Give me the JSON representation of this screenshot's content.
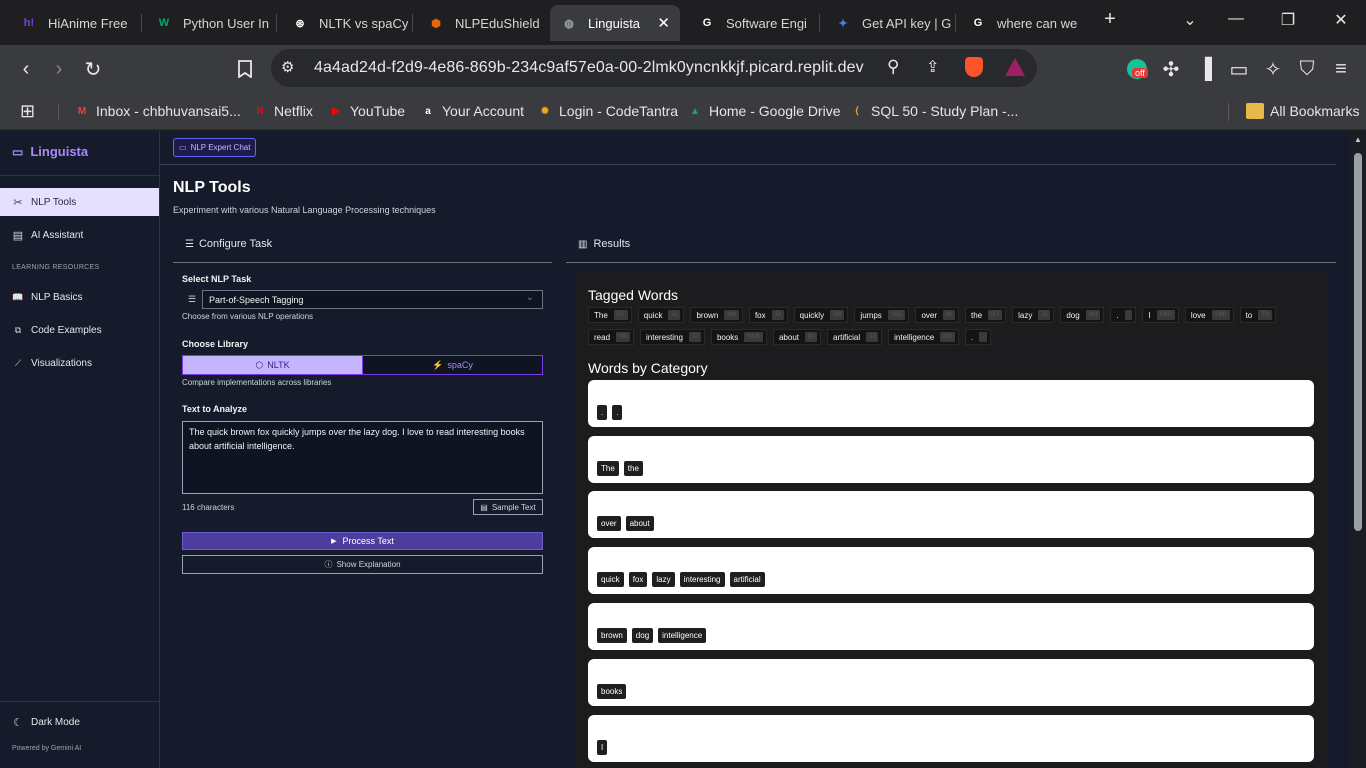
{
  "browser": {
    "tabs": [
      {
        "title": "HiAnime Free",
        "icon": "hianime-icon",
        "color": "#7c3aed",
        "glyph": "h!"
      },
      {
        "title": "Python User In",
        "icon": "w3schools-icon",
        "color": "#04aa6d",
        "glyph": "W"
      },
      {
        "title": "NLTK vs spaCy",
        "icon": "chatgpt-icon",
        "color": "#ffffff",
        "glyph": "⊛"
      },
      {
        "title": "NLPEduShield",
        "icon": "replit-icon",
        "color": "#f26207",
        "glyph": "⬢"
      },
      {
        "title": "Linguista",
        "icon": "globe-icon",
        "color": "#9aa0a6",
        "glyph": "◍"
      },
      {
        "title": "Software Engi",
        "icon": "google-icon",
        "color": "#ffffff",
        "glyph": "G"
      },
      {
        "title": "Get API key | G",
        "icon": "gemini-icon",
        "color": "#4285f4",
        "glyph": "✦"
      },
      {
        "title": "where can we",
        "icon": "google-icon",
        "color": "#ffffff",
        "glyph": "G"
      }
    ],
    "active_tab_index": 4,
    "url": "4a4ad24d-f2d9-4e86-869b-234c9af57e0a-00-2lmk0yncnkkjf.picard.replit.dev",
    "extension_badge": "off",
    "bookmarks": [
      {
        "label": "Inbox - chbhuvansai5...",
        "icon": "gmail-icon",
        "color": "#ea4335",
        "glyph": "M"
      },
      {
        "label": "Netflix",
        "icon": "netflix-icon",
        "color": "#e50914",
        "glyph": "N"
      },
      {
        "label": "YouTube",
        "icon": "youtube-icon",
        "color": "#ff0000",
        "glyph": "▶"
      },
      {
        "label": "Your Account",
        "icon": "amazon-icon",
        "color": "#ffffff",
        "glyph": "a"
      },
      {
        "label": "Login - CodeTantra",
        "icon": "codetantra-icon",
        "color": "#f5a623",
        "glyph": "✹"
      },
      {
        "label": "Home - Google Drive",
        "icon": "google-drive-icon",
        "color": "#1fa463",
        "glyph": "▲"
      },
      {
        "label": "SQL 50 - Study Plan -...",
        "icon": "leetcode-icon",
        "color": "#ffa116",
        "glyph": "⟨"
      }
    ],
    "all_bookmarks_label": "All Bookmarks"
  },
  "sidebar": {
    "brand": "Linguista",
    "items": [
      {
        "label": "NLP Tools",
        "icon": "tools-icon",
        "glyph": "✂",
        "active": true
      },
      {
        "label": "AI Assistant",
        "icon": "chat-icon",
        "glyph": "▤",
        "active": false
      }
    ],
    "section_heading": "LEARNING RESOURCES",
    "resources": [
      {
        "label": "NLP Basics",
        "icon": "book-icon",
        "glyph": "📖"
      },
      {
        "label": "Code Examples",
        "icon": "code-icon",
        "glyph": "⧉"
      },
      {
        "label": "Visualizations",
        "icon": "chart-icon",
        "glyph": "⟋"
      }
    ],
    "dark_mode_label": "Dark Mode",
    "powered_by": "Powered by Gemini AI"
  },
  "main": {
    "chat_button": "NLP Expert Chat",
    "title": "NLP Tools",
    "subtitle": "Experiment with various Natural Language Processing techniques",
    "configure": {
      "title": "Configure Task",
      "select_label": "Select NLP Task",
      "select_value": "Part-of-Speech Tagging",
      "select_hint": "Choose from various NLP operations",
      "library_label": "Choose Library",
      "library_options": [
        "NLTK",
        "spaCy"
      ],
      "library_selected": "NLTK",
      "library_hint": "Compare implementations across libraries",
      "text_label": "Text to Analyze",
      "text_value": "The quick brown fox quickly jumps over the lazy dog. I love to read interesting books about artificial intelligence.",
      "char_count": "116 characters",
      "sample_button": "Sample Text",
      "process_button": "Process Text",
      "explain_button": "Show Explanation"
    },
    "results": {
      "title": "Results",
      "tagged_heading": "Tagged Words",
      "tagged_words": [
        {
          "word": "The",
          "tag": "DT"
        },
        {
          "word": "quick",
          "tag": "JJ"
        },
        {
          "word": "brown",
          "tag": "NN"
        },
        {
          "word": "fox",
          "tag": "JJ"
        },
        {
          "word": "quickly",
          "tag": "RB"
        },
        {
          "word": "jumps",
          "tag": "VBZ"
        },
        {
          "word": "over",
          "tag": "IN"
        },
        {
          "word": "the",
          "tag": "DT"
        },
        {
          "word": "lazy",
          "tag": "JJ"
        },
        {
          "word": "dog",
          "tag": "NN"
        },
        {
          "word": ".",
          "tag": "."
        },
        {
          "word": "I",
          "tag": "PRP"
        },
        {
          "word": "love",
          "tag": "VBP"
        },
        {
          "word": "to",
          "tag": "TO"
        },
        {
          "word": "read",
          "tag": "VB"
        },
        {
          "word": "interesting",
          "tag": "JJ"
        },
        {
          "word": "books",
          "tag": "NNS"
        },
        {
          "word": "about",
          "tag": "IN"
        },
        {
          "word": "artificial",
          "tag": "JJ"
        },
        {
          "word": "intelligence",
          "tag": "NN"
        },
        {
          "word": ".",
          "tag": "."
        }
      ],
      "category_heading": "Words by Category",
      "categories": [
        [
          ".",
          "."
        ],
        [
          "The",
          "the"
        ],
        [
          "over",
          "about"
        ],
        [
          "quick",
          "fox",
          "lazy",
          "interesting",
          "artificial"
        ],
        [
          "brown",
          "dog",
          "intelligence"
        ],
        [
          "books"
        ],
        [
          "I"
        ]
      ]
    }
  }
}
